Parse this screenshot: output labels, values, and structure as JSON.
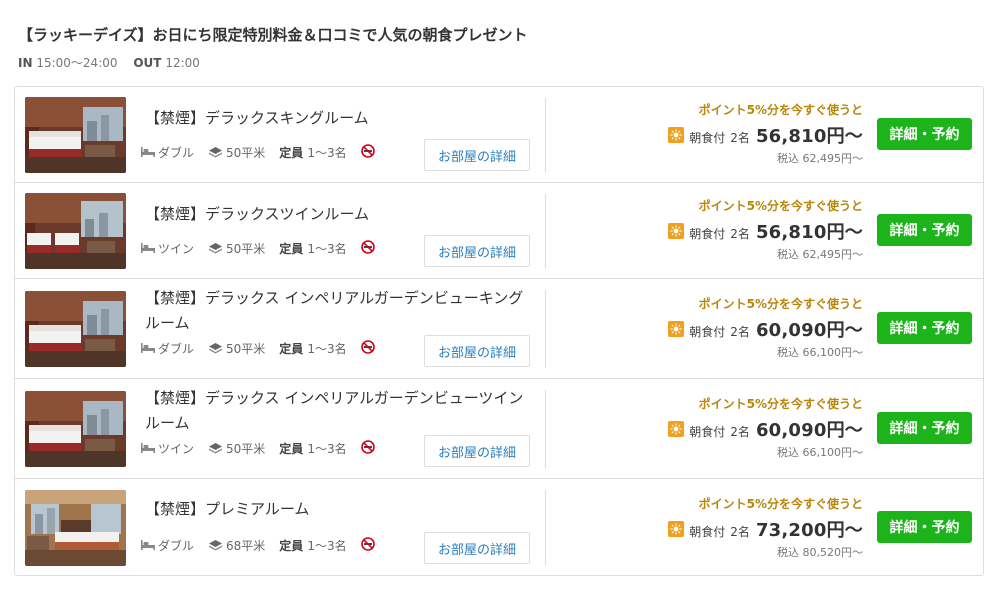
{
  "plan": {
    "title": "【ラッキーデイズ】お日にち限定特別料金＆口コミで人気の朝食プレゼント",
    "in_label": "IN",
    "in_time": "15:00〜24:00",
    "out_label": "OUT",
    "out_time": "12:00"
  },
  "rooms": [
    {
      "name": "【禁煙】デラックスキングルーム",
      "bed": "ダブル",
      "area": "50平米",
      "capacity_label": "定員",
      "capacity": "1〜3名",
      "detail_label": "お部屋の詳細",
      "points_text": "ポイント5%分を今すぐ使うと",
      "meal": "朝食付",
      "persons": "2名",
      "price": "56,810円〜",
      "tax": "税込 62,495円〜",
      "book_label": "詳細・予約"
    },
    {
      "name": "【禁煙】デラックスツインルーム",
      "bed": "ツイン",
      "area": "50平米",
      "capacity_label": "定員",
      "capacity": "1〜3名",
      "detail_label": "お部屋の詳細",
      "points_text": "ポイント5%分を今すぐ使うと",
      "meal": "朝食付",
      "persons": "2名",
      "price": "56,810円〜",
      "tax": "税込 62,495円〜",
      "book_label": "詳細・予約"
    },
    {
      "name": "【禁煙】デラックス インペリアルガーデンビューキングルーム",
      "bed": "ダブル",
      "area": "50平米",
      "capacity_label": "定員",
      "capacity": "1〜3名",
      "detail_label": "お部屋の詳細",
      "points_text": "ポイント5%分を今すぐ使うと",
      "meal": "朝食付",
      "persons": "2名",
      "price": "60,090円〜",
      "tax": "税込 66,100円〜",
      "book_label": "詳細・予約"
    },
    {
      "name": "【禁煙】デラックス インペリアルガーデンビューツインルーム",
      "bed": "ツイン",
      "area": "50平米",
      "capacity_label": "定員",
      "capacity": "1〜3名",
      "detail_label": "お部屋の詳細",
      "points_text": "ポイント5%分を今すぐ使うと",
      "meal": "朝食付",
      "persons": "2名",
      "price": "60,090円〜",
      "tax": "税込 66,100円〜",
      "book_label": "詳細・予約"
    },
    {
      "name": "【禁煙】プレミアルーム",
      "bed": "ダブル",
      "area": "68平米",
      "capacity_label": "定員",
      "capacity": "1〜3名",
      "detail_label": "お部屋の詳細",
      "points_text": "ポイント5%分を今すぐ使うと",
      "meal": "朝食付",
      "persons": "2名",
      "price": "73,200円〜",
      "tax": "税込 80,520円〜",
      "book_label": "詳細・予約"
    }
  ],
  "icons": {
    "bed": "bed-icon",
    "area": "floor-area-icon",
    "no_smoking": "no-smoking-icon",
    "meal": "breakfast-icon"
  },
  "colors": {
    "book_button": "#1db31a",
    "points_text": "#b8860b",
    "link": "#2a7fc1",
    "meal_icon": "#f0a020",
    "no_smoking": "#d0021b"
  }
}
